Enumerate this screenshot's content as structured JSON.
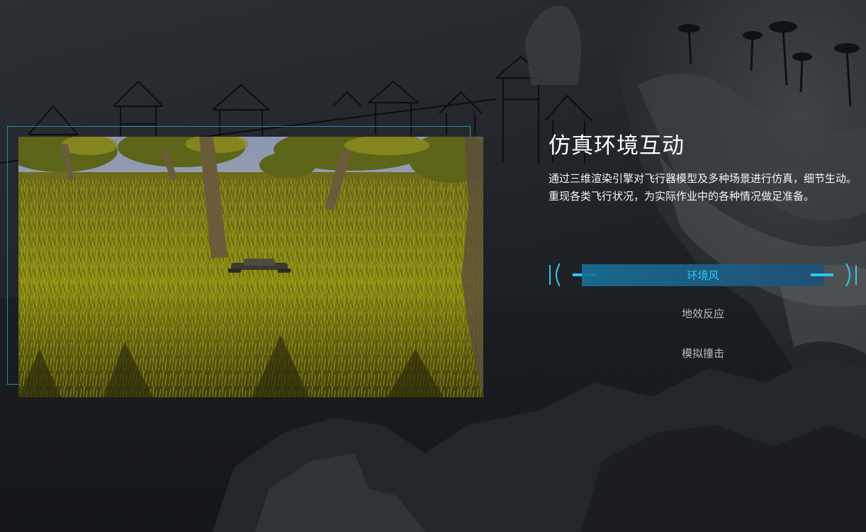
{
  "section": {
    "title": "仿真环境互动",
    "description": "通过三维渲染引擎对飞行器模型及多种场景进行仿真，细节生动。重现各类飞行状况，为实际作业中的各种情况做足准备。"
  },
  "video": {
    "scene": "drone-over-grass-scene"
  },
  "tabs": [
    {
      "label": "环境风",
      "active": true
    },
    {
      "label": "地效反应",
      "active": false
    },
    {
      "label": "模拟撞击",
      "active": false
    }
  ],
  "colors": {
    "accent": "#2fc7ee",
    "active_bar": "#1c6f95",
    "outline": "#1f8fa3",
    "background": "#14171b"
  }
}
